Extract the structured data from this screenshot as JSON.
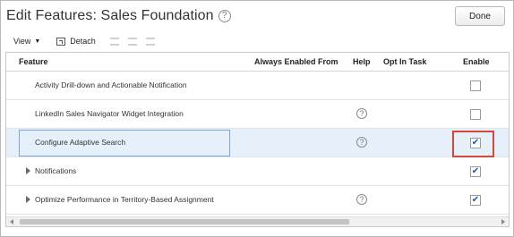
{
  "dialog": {
    "title": "Edit Features: Sales Foundation",
    "help_glyph": "?",
    "done_label": "Done"
  },
  "toolbar": {
    "view_label": "View",
    "view_caret": "▼",
    "detach_label": "Detach"
  },
  "table": {
    "columns": {
      "feature": "Feature",
      "always_enabled_from": "Always Enabled From",
      "help": "Help",
      "opt_in_task": "Opt In Task",
      "enable": "Enable"
    },
    "rows": [
      {
        "feature": "Activity Drill-down and Actionable Notification",
        "expandable": false,
        "has_help": false,
        "enabled": false,
        "selected": false
      },
      {
        "feature": "LinkedIn Sales Navigator Widget Integration",
        "expandable": false,
        "has_help": true,
        "enabled": false,
        "selected": false
      },
      {
        "feature": "Configure Adaptive Search",
        "expandable": false,
        "has_help": true,
        "enabled": true,
        "selected": true,
        "highlighted": true
      },
      {
        "feature": "Notifications",
        "expandable": true,
        "has_help": false,
        "enabled": true,
        "selected": false
      },
      {
        "feature": "Optimize Performance in Territory-Based Assignment",
        "expandable": true,
        "has_help": true,
        "enabled": true,
        "selected": false
      }
    ],
    "checkmark_glyph": "✔"
  },
  "colors": {
    "selected_row": "#e6f0fa",
    "highlight_border": "#d04a3c",
    "checkmark": "#1e5aa8"
  }
}
